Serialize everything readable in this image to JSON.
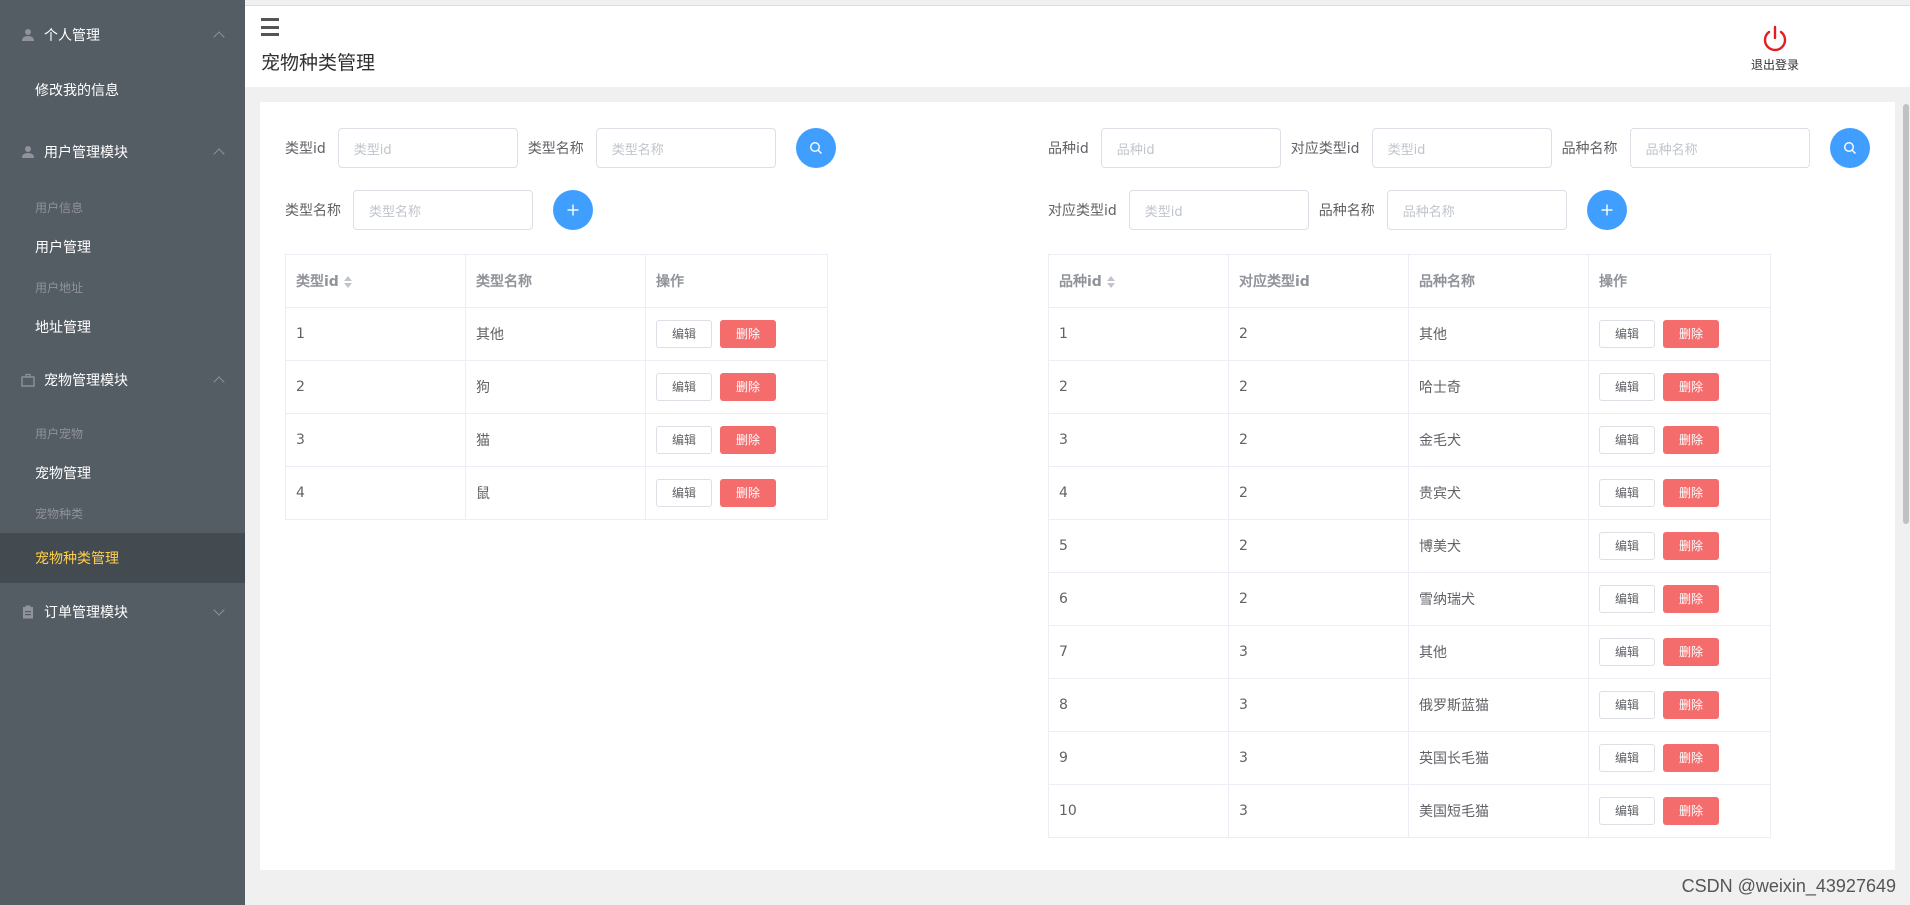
{
  "sidebar": {
    "groups": [
      {
        "title": "个人管理",
        "items": [
          {
            "label": "修改我的信息"
          }
        ]
      },
      {
        "title": "用户管理模块",
        "sections": [
          {
            "label": "用户信息",
            "item": "用户管理"
          },
          {
            "label": "用户地址",
            "item": "地址管理"
          }
        ]
      },
      {
        "title": "宠物管理模块",
        "sections": [
          {
            "label": "用户宠物",
            "item": "宠物管理"
          },
          {
            "label": "宠物种类",
            "item": "宠物种类管理"
          }
        ]
      },
      {
        "title": "订单管理模块"
      }
    ],
    "active_color": "#ffd04b"
  },
  "header": {
    "title": "宠物种类管理",
    "logout_label": "退出登录"
  },
  "type_panel": {
    "search": {
      "id_label": "类型id",
      "id_placeholder": "类型id",
      "name_label": "类型名称",
      "name_placeholder": "类型名称"
    },
    "add": {
      "name_label": "类型名称",
      "name_placeholder": "类型名称"
    },
    "columns": [
      "类型id",
      "类型名称",
      "操作"
    ],
    "rows": [
      {
        "id": "1",
        "name": "其他"
      },
      {
        "id": "2",
        "name": "狗"
      },
      {
        "id": "3",
        "name": "猫"
      },
      {
        "id": "4",
        "name": "鼠"
      }
    ]
  },
  "breed_panel": {
    "search": {
      "id_label": "品种id",
      "id_placeholder": "品种id",
      "type_label": "对应类型id",
      "type_placeholder": "类型id",
      "name_label": "品种名称",
      "name_placeholder": "品种名称"
    },
    "add": {
      "type_label": "对应类型id",
      "type_placeholder": "类型id",
      "name_label": "品种名称",
      "name_placeholder": "品种名称"
    },
    "columns": [
      "品种id",
      "对应类型id",
      "品种名称",
      "操作"
    ],
    "rows": [
      {
        "id": "1",
        "type_id": "2",
        "name": "其他"
      },
      {
        "id": "2",
        "type_id": "2",
        "name": "哈士奇"
      },
      {
        "id": "3",
        "type_id": "2",
        "name": "金毛犬"
      },
      {
        "id": "4",
        "type_id": "2",
        "name": "贵宾犬"
      },
      {
        "id": "5",
        "type_id": "2",
        "name": "博美犬"
      },
      {
        "id": "6",
        "type_id": "2",
        "name": "雪纳瑞犬"
      },
      {
        "id": "7",
        "type_id": "3",
        "name": "其他"
      },
      {
        "id": "8",
        "type_id": "3",
        "name": "俄罗斯蓝猫"
      },
      {
        "id": "9",
        "type_id": "3",
        "name": "英国长毛猫"
      },
      {
        "id": "10",
        "type_id": "3",
        "name": "美国短毛猫"
      }
    ]
  },
  "buttons": {
    "edit": "编辑",
    "delete": "删除"
  },
  "colors": {
    "primary": "#409eff",
    "danger": "#f56c6c",
    "logout": "#e02020"
  },
  "watermark": "CSDN @weixin_43927649"
}
